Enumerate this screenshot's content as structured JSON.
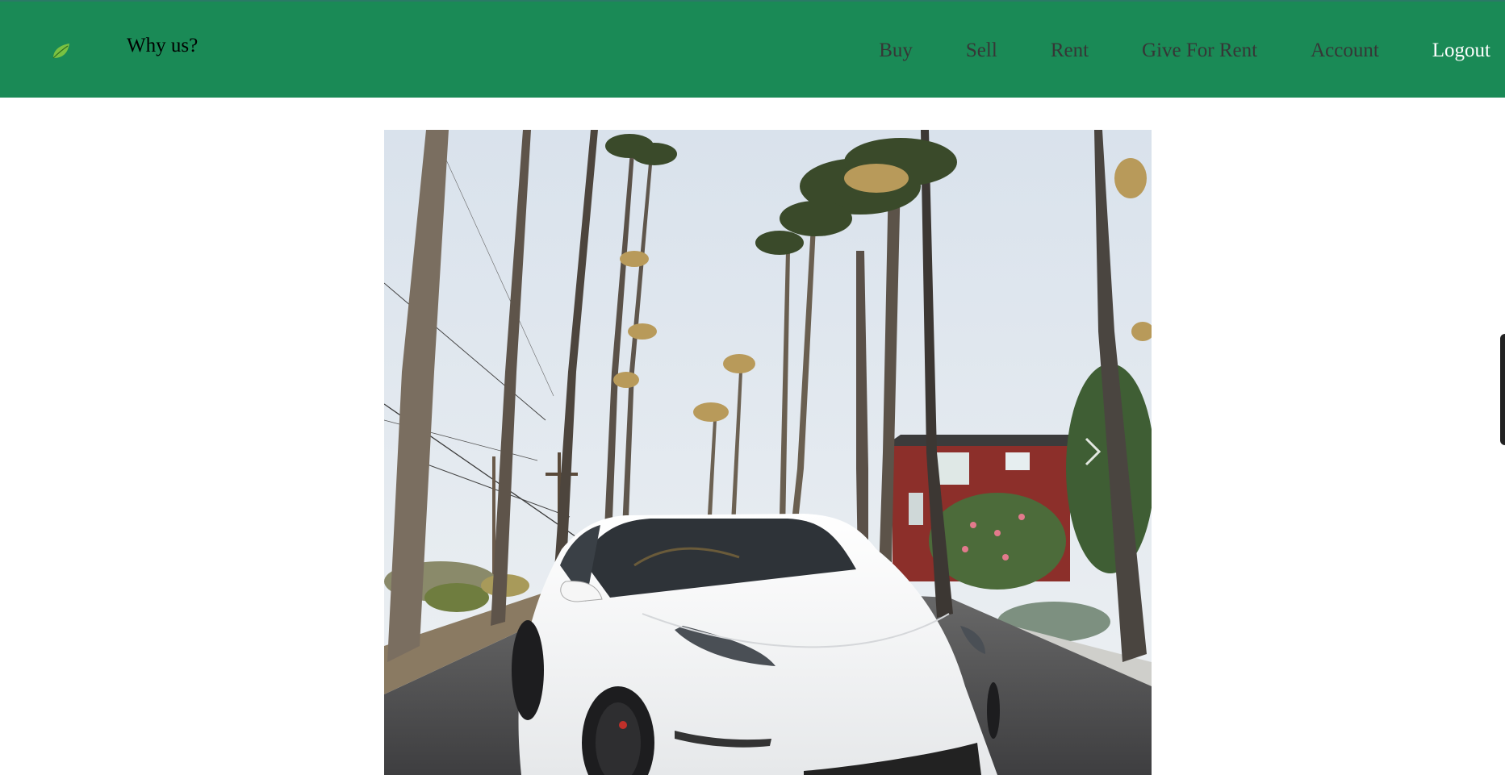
{
  "header": {
    "logo_icon": "leaf-icon",
    "why_us_label": "Why us?",
    "nav": {
      "buy": "Buy",
      "sell": "Sell",
      "rent": "Rent",
      "give_for_rent": "Give For Rent",
      "account": "Account",
      "logout": "Logout"
    }
  },
  "hero": {
    "image_subject": "white-car-palm-street-photo",
    "next_icon": "chevron-right-icon"
  },
  "colors": {
    "navbar_bg": "#1a8a56",
    "logout_text": "#ffffff",
    "nav_text": "#363636"
  }
}
